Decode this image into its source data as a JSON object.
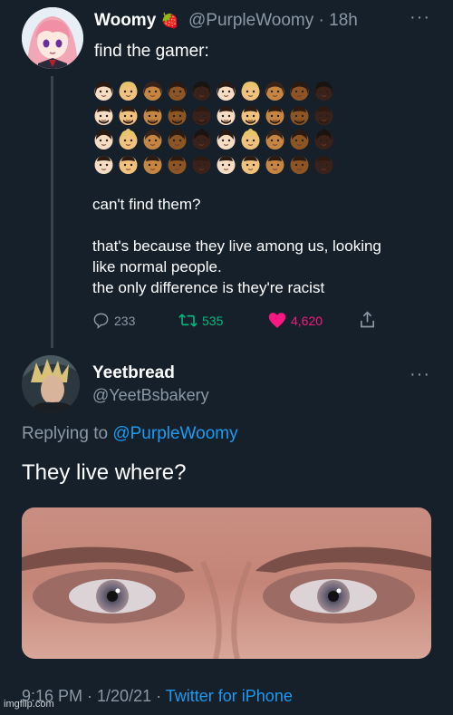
{
  "tweet1": {
    "name": "Woomy",
    "badge": "🍓",
    "handle": "@PurpleWoomy",
    "time": "· 18h",
    "more": "···",
    "text1": "find the gamer:",
    "text2": "can't find them?",
    "text3_line1": "that's because they live among us, looking",
    "text3_line2": "like normal people.",
    "text3_line3": "the only difference is they're racist",
    "replies": "233",
    "retweets": "535",
    "likes": "4,620",
    "emoji_grid": {
      "rows": 4,
      "cols": 10,
      "skin_tones": [
        "#f7dcc4",
        "#f1c27d",
        "#c68642",
        "#8d5524",
        "#3b2219"
      ]
    },
    "colors": {
      "retweet": "#00ba7c",
      "like": "#f91880"
    }
  },
  "tweet2": {
    "name": "Yeetbread",
    "handle": "@YeetBsbakery",
    "more": "···",
    "reply_prefix": "Replying to",
    "reply_handle": "@PurpleWoomy",
    "text": "They live where?",
    "meta_time": "9:16 PM · 1/20/21 ·",
    "meta_source": "Twitter for iPhone"
  },
  "watermark": "imgflip.com",
  "colors": {
    "background": "#15202b",
    "muted": "#8b98a5",
    "link": "#1d9bf0"
  }
}
